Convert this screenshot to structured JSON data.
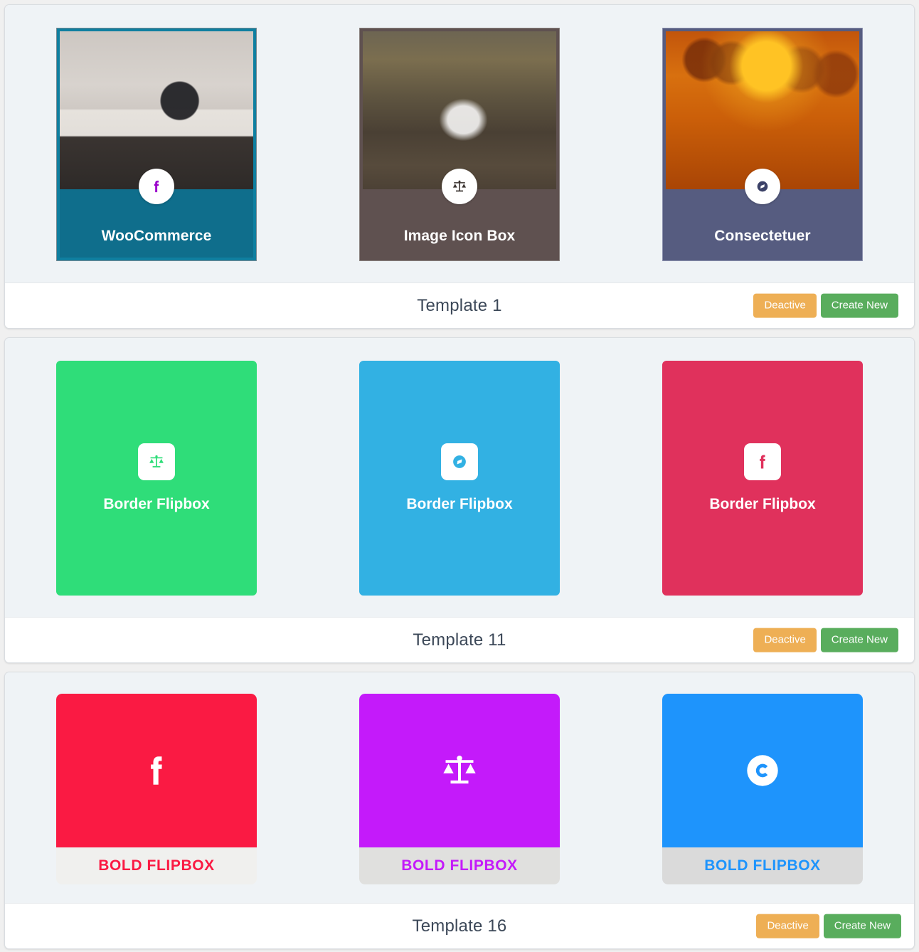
{
  "colors": {
    "page_bg": "#f0f0f0",
    "block_bg": "#eff3f6",
    "footer_bg": "#ffffff",
    "btn_deactive": "#eeaf55",
    "btn_create": "#59ad5d",
    "title_text": "#3c4858"
  },
  "actions": {
    "deactive_label": "Deactive",
    "create_new_label": "Create New"
  },
  "templates": [
    {
      "id": "template-1",
      "footer_title": "Template 1",
      "style": "image-icon-box",
      "cards": [
        {
          "title": "WooCommerce",
          "icon": "facebook-f-icon",
          "icon_color": "#9b00cc",
          "panel_color": "#0f6e8c",
          "frame_color": "#0f7fa0",
          "outer_border": "#7a8a92",
          "photo": "photo-room"
        },
        {
          "title": "Image Icon Box",
          "icon": "balance-scale-icon",
          "icon_color": "#3b3431",
          "panel_color": "#5f5150",
          "frame_color": "#5f5150",
          "outer_border": "#8a8280",
          "photo": "photo-dog"
        },
        {
          "title": "Consectetuer",
          "icon": "compass-icon",
          "icon_color": "#3c4268",
          "panel_color": "#565c80",
          "frame_color": "#565c80",
          "outer_border": "#8b90ad",
          "photo": "photo-bulbs"
        }
      ]
    },
    {
      "id": "template-11",
      "footer_title": "Template 11",
      "style": "border-flipbox",
      "cards": [
        {
          "title": "Border Flipbox",
          "icon": "balance-scale-icon",
          "bg_color": "#2fdd79",
          "icon_color": "#2fdd79"
        },
        {
          "title": "Border Flipbox",
          "icon": "compass-icon",
          "bg_color": "#32b1e3",
          "icon_color": "#32b1e3"
        },
        {
          "title": "Border Flipbox",
          "icon": "facebook-f-icon",
          "bg_color": "#e0315c",
          "icon_color": "#e0315c"
        }
      ]
    },
    {
      "id": "template-16",
      "footer_title": "Template 16",
      "style": "bold-flipbox",
      "cards": [
        {
          "title": "BOLD FLIPBOX",
          "icon": "facebook-f-icon",
          "bg_color": "#fa1a43",
          "caption_bg": "#f0f0ee",
          "caption_color": "#fa1a43"
        },
        {
          "title": "BOLD FLIPBOX",
          "icon": "balance-scale-icon",
          "bg_color": "#c41afa",
          "caption_bg": "#e0e0de",
          "caption_color": "#c41afa"
        },
        {
          "title": "BOLD FLIPBOX",
          "icon": "copyright-c-icon",
          "bg_color": "#1e94fc",
          "caption_bg": "#dadada",
          "caption_color": "#1e94fc"
        }
      ]
    }
  ]
}
